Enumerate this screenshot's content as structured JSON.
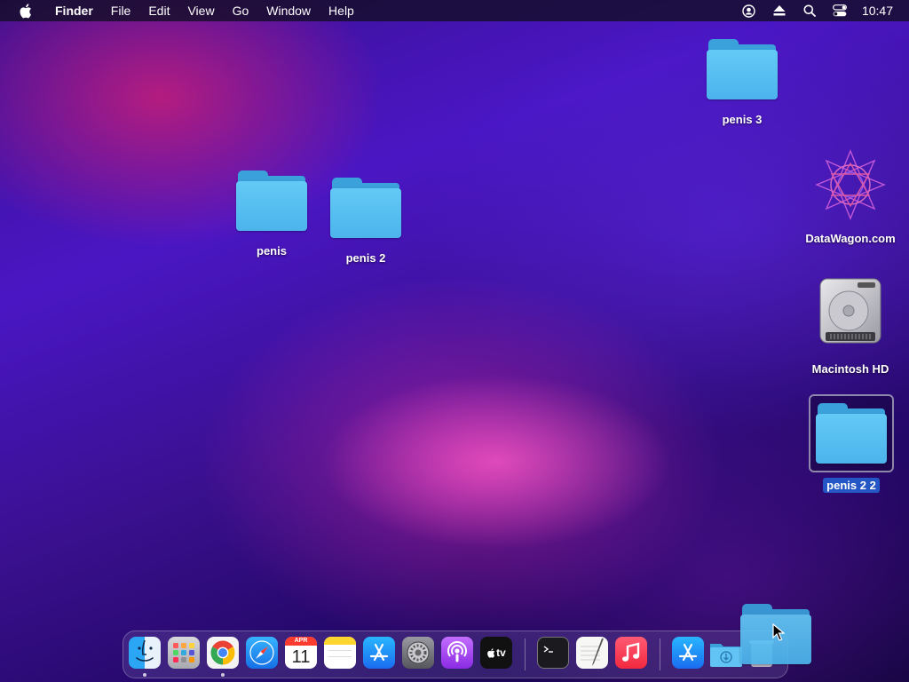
{
  "menubar": {
    "app_name": "Finder",
    "items": [
      "File",
      "Edit",
      "View",
      "Go",
      "Window",
      "Help"
    ],
    "clock": "10:47",
    "status_icons": [
      "user-icon",
      "eject-icon",
      "search-icon",
      "control-center-icon"
    ]
  },
  "desktop": {
    "icons": [
      {
        "label": "penis 3",
        "type": "folder"
      },
      {
        "label": "penis",
        "type": "folder"
      },
      {
        "label": "penis 2",
        "type": "folder"
      },
      {
        "label": "DataWagon.com",
        "type": "app"
      },
      {
        "label": "Macintosh HD",
        "type": "disk"
      },
      {
        "label": "penis 2 2",
        "type": "folder",
        "selected": true
      }
    ]
  },
  "dock": {
    "apps": [
      {
        "name": "finder-icon",
        "running": true
      },
      {
        "name": "launchpad-icon",
        "running": false
      },
      {
        "name": "chrome-icon",
        "running": true
      },
      {
        "name": "safari-icon",
        "running": false
      },
      {
        "name": "calendar-icon",
        "running": false,
        "month": "APR",
        "day": "11"
      },
      {
        "name": "notes-icon",
        "running": false
      },
      {
        "name": "app-store-icon",
        "running": false
      },
      {
        "name": "system-preferences-icon",
        "running": false
      },
      {
        "name": "podcasts-icon",
        "running": false
      },
      {
        "name": "apple-tv-icon",
        "running": false,
        "text": "tv"
      },
      {
        "name": "terminal-icon",
        "running": false
      },
      {
        "name": "textedit-icon",
        "running": false
      },
      {
        "name": "music-icon",
        "running": false
      },
      {
        "name": "app-store-downloads-icon",
        "running": false
      },
      {
        "name": "downloads-folder-icon",
        "running": false
      },
      {
        "name": "trash-icon",
        "running": false
      }
    ]
  },
  "colors": {
    "folder_front": "#5cc3f4",
    "folder_back": "#3aa1db",
    "selection": "#2457c5",
    "menubar": "#140e28"
  }
}
